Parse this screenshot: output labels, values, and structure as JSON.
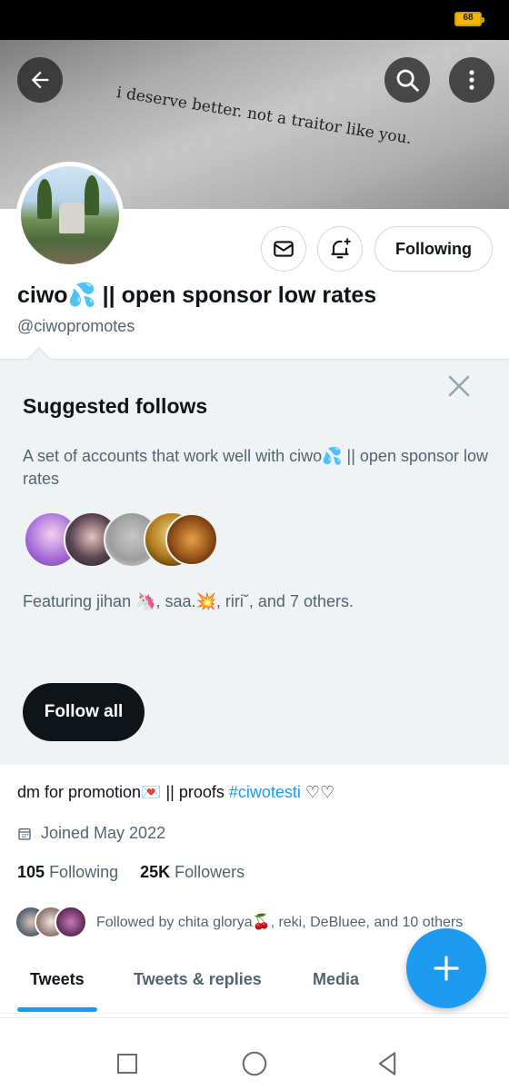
{
  "status_bar": {
    "battery": "68"
  },
  "banner": {
    "quote": "i deserve better. not a traitor like you."
  },
  "profile": {
    "display_name": "ciwo💦 || open sponsor low rates",
    "handle": "@ciwopromotes",
    "following_button": "Following",
    "bio_text": "dm for promotion💌 || proofs ",
    "bio_hashtag": "#ciwotesti",
    "bio_suffix": " ♡♡",
    "joined": "Joined May 2022",
    "following_count": "105",
    "following_label": "Following",
    "followers_count": "25K",
    "followers_label": "Followers",
    "followed_by": "Followed by chita glorya🍒, reki, DeBluee, and 10 others"
  },
  "suggested": {
    "title": "Suggested follows",
    "description": "A set of accounts that work well with ciwo💦 || open sponsor low rates",
    "featuring": "Featuring jihan 🦄, saa.💥, riri˘, and 7 others.",
    "follow_all": "Follow all"
  },
  "tabs": [
    {
      "label": "Tweets"
    },
    {
      "label": "Tweets & replies"
    },
    {
      "label": "Media"
    }
  ],
  "colors": {
    "accent": "#1d9bf0",
    "panel_bg": "#eff3f4",
    "text_primary": "#0f1419",
    "text_secondary": "#536471"
  },
  "icons": [
    "back-arrow-icon",
    "search-icon",
    "more-vertical-icon",
    "mail-icon",
    "bell-plus-icon",
    "close-icon",
    "calendar-icon",
    "compose-plus-icon",
    "nav-square-icon",
    "nav-circle-icon",
    "nav-back-triangle-icon"
  ]
}
